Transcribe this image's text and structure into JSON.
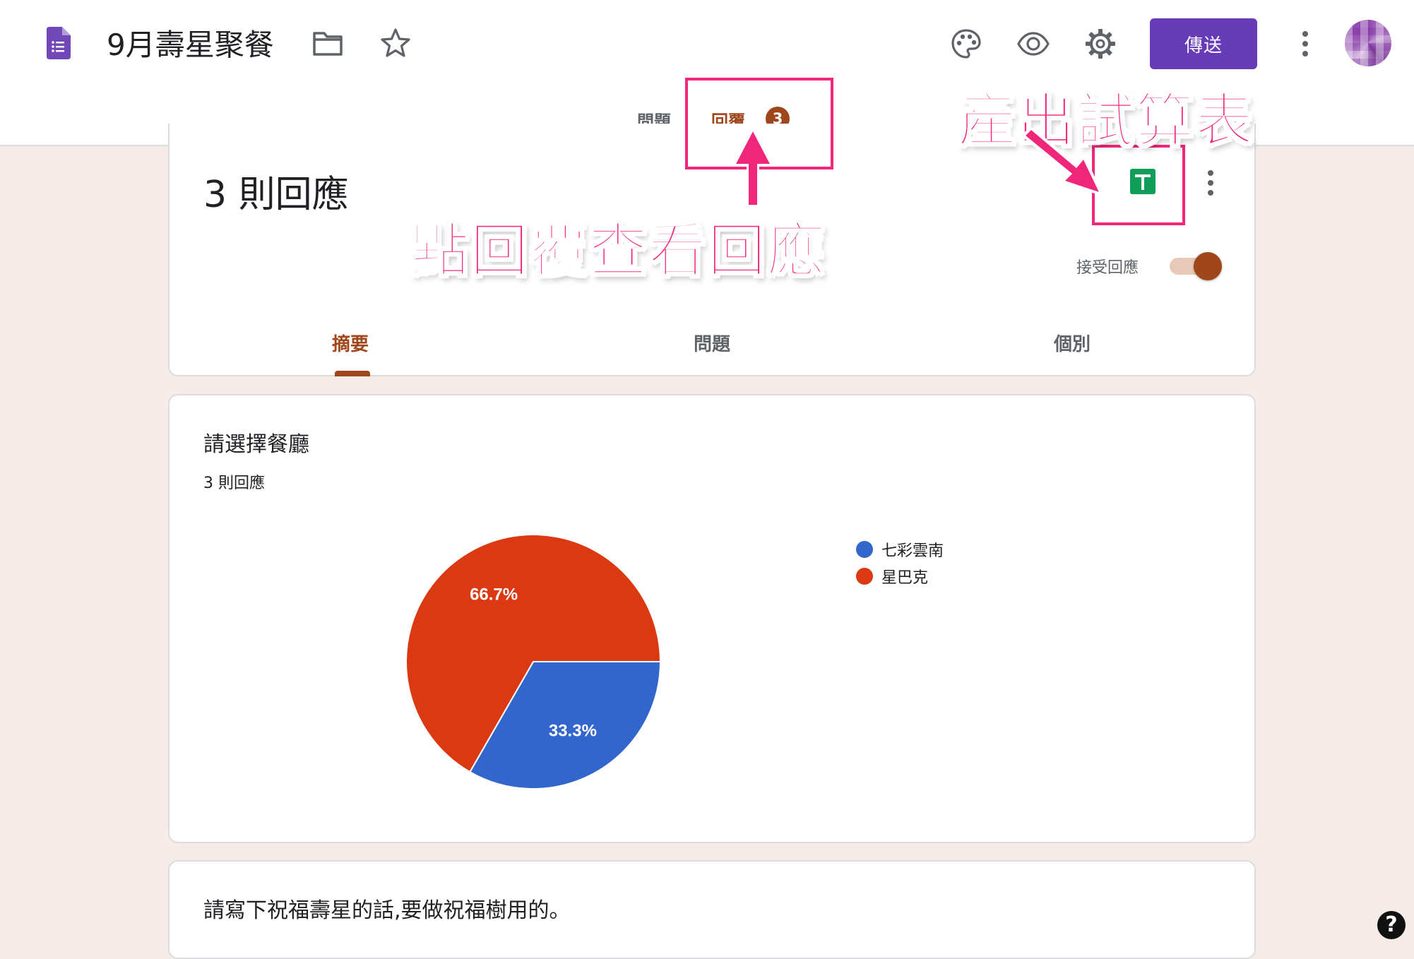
{
  "header": {
    "title": "9月壽星聚餐",
    "send_label": "傳送",
    "icons": [
      "forms-logo-icon",
      "folder-icon",
      "star-icon",
      "palette-icon",
      "eye-icon",
      "gear-icon",
      "more-vert-icon",
      "avatar"
    ],
    "tabs": [
      {
        "label": "問題"
      },
      {
        "label": "回覆",
        "count": "3",
        "active": true
      }
    ],
    "accent_color": "#673ab7",
    "theme_color": "#a0461b"
  },
  "responses_card": {
    "title": "3 則回應",
    "accept_label": "接受回應",
    "accepting": true,
    "subtabs": [
      "摘要",
      "問題",
      "個別"
    ]
  },
  "questions": [
    {
      "title": "請選擇餐廳",
      "count_label": "3 則回應",
      "chart_data": {
        "type": "pie",
        "series": [
          {
            "name": "七彩雲南",
            "value": 33.3,
            "label": "33.3%",
            "color": "#3366cc"
          },
          {
            "name": "星巴克",
            "value": 66.7,
            "label": "66.7%",
            "color": "#dc3912"
          }
        ],
        "legend": "right"
      }
    },
    {
      "title": "請寫下祝福壽星的話,要做祝福樹用的。"
    }
  ],
  "annotations": {
    "export_label": "產出試算表",
    "click_label": "點回覆查看回應",
    "color": "#f0277a"
  },
  "help_label": "?"
}
